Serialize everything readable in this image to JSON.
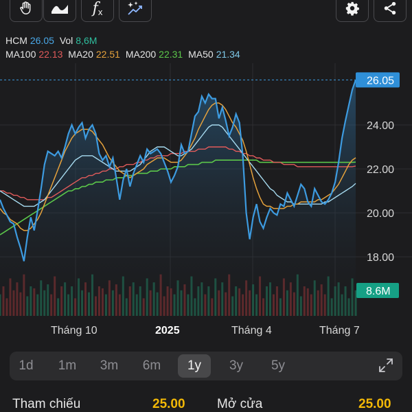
{
  "toolbar": {
    "left_buttons": [
      "hand-icon",
      "area-chart-icon",
      "function-icon",
      "sparkle-chart-icon"
    ],
    "right_buttons": [
      "gear-icon",
      "share-icon"
    ]
  },
  "legend": {
    "symbol": "HCM",
    "price": "26.05",
    "vol_label": "Vol",
    "vol": "8,6M",
    "ma": [
      {
        "label": "MA100",
        "value": "22.13",
        "color": "#e25b5b"
      },
      {
        "label": "MA20",
        "value": "22.51",
        "color": "#e6a23c"
      },
      {
        "label": "MA200",
        "value": "22.31",
        "color": "#5cc84a"
      },
      {
        "label": "MA50",
        "value": "21.34",
        "color": "#7ec8e8"
      }
    ]
  },
  "chart_data": {
    "type": "line",
    "symbol": "HCM",
    "y_ticks": [
      "26.05",
      "24.00",
      "22.00",
      "20.00",
      "18.00"
    ],
    "last_price": "26.05",
    "volume_label": "8.6M",
    "x_ticks": [
      "Tháng 10",
      "2025",
      "Tháng 4",
      "Tháng 7"
    ],
    "ylim": [
      17,
      26.5
    ],
    "price": [
      20.6,
      20.2,
      19.9,
      19.6,
      19.5,
      18.9,
      18.4,
      17.8,
      18.9,
      19.8,
      19.2,
      20.1,
      21.1,
      22.2,
      22.8,
      22.7,
      22.6,
      22.8,
      22.5,
      23.0,
      23.6,
      24.0,
      23.6,
      23.9,
      24.1,
      23.4,
      23.8,
      24.0,
      23.6,
      22.7,
      22.4,
      22.6,
      22.1,
      22.5,
      21.6,
      20.6,
      21.5,
      22.0,
      21.2,
      21.8,
      22.2,
      22.6,
      22.3,
      22.9,
      22.7,
      22.8,
      22.9,
      22.7,
      22.3,
      21.9,
      21.4,
      21.7,
      22.1,
      23.1,
      22.7,
      22.8,
      23.6,
      24.4,
      24.6,
      25.3,
      25.0,
      25.4,
      25.2,
      25.2,
      24.3,
      24.8,
      24.2,
      23.5,
      23.9,
      24.5,
      24.1,
      22.6,
      20.0,
      18.8,
      19.8,
      20.4,
      19.6,
      19.3,
      19.8,
      20.2,
      20.0,
      19.9,
      20.4,
      20.3,
      20.9,
      20.6,
      20.3,
      20.8,
      21.3,
      21.1,
      20.5,
      20.3,
      21.1,
      20.8,
      20.5,
      20.4,
      20.6,
      20.9,
      21.4,
      22.3,
      23.4,
      24.2,
      24.9,
      25.6,
      26.05
    ],
    "ma20": [
      20.2,
      20.0,
      19.9,
      19.7,
      19.6,
      19.5,
      19.3,
      19.2,
      19.2,
      19.3,
      19.5,
      19.7,
      20.0,
      20.4,
      20.8,
      21.2,
      21.6,
      22.0,
      22.4,
      22.8,
      23.1,
      23.4,
      23.6,
      23.7,
      23.8,
      23.8,
      23.8,
      23.7,
      23.5,
      23.3,
      23.1,
      22.8,
      22.5,
      22.3,
      22.1,
      21.9,
      21.8,
      21.7,
      21.6,
      21.7,
      21.8,
      21.9,
      22.0,
      22.2,
      22.3,
      22.4,
      22.5,
      22.5,
      22.5,
      22.4,
      22.3,
      22.3,
      22.3,
      22.4,
      22.6,
      22.8,
      23.1,
      23.4,
      23.8,
      24.1,
      24.4,
      24.7,
      24.9,
      25.0,
      25.0,
      24.9,
      24.7,
      24.4,
      24.1,
      23.9,
      23.6,
      23.3,
      22.8,
      22.2,
      21.6,
      21.1,
      20.7,
      20.4,
      20.3,
      20.3,
      20.2,
      20.2,
      20.2,
      20.2,
      20.3,
      20.3,
      20.4,
      20.4,
      20.5,
      20.5,
      20.5,
      20.5,
      20.5,
      20.6,
      20.6,
      20.7,
      20.8,
      20.9,
      21.1,
      21.3,
      21.6,
      21.9,
      22.2,
      22.4,
      22.51
    ],
    "ma50": [
      21.0,
      20.9,
      20.8,
      20.7,
      20.6,
      20.5,
      20.4,
      20.3,
      20.3,
      20.3,
      20.3,
      20.4,
      20.5,
      20.6,
      20.8,
      21.0,
      21.2,
      21.4,
      21.6,
      21.8,
      22.0,
      22.2,
      22.4,
      22.5,
      22.6,
      22.6,
      22.6,
      22.6,
      22.5,
      22.4,
      22.3,
      22.2,
      22.1,
      22.0,
      21.9,
      21.9,
      21.9,
      21.9,
      21.9,
      22.0,
      22.1,
      22.2,
      22.4,
      22.6,
      22.8,
      22.9,
      23.0,
      23.0,
      23.0,
      22.9,
      22.8,
      22.7,
      22.6,
      22.6,
      22.7,
      22.8,
      22.9,
      23.1,
      23.3,
      23.5,
      23.7,
      23.9,
      24.0,
      24.0,
      24.0,
      23.9,
      23.7,
      23.5,
      23.3,
      23.1,
      22.9,
      22.7,
      22.5,
      22.3,
      22.1,
      21.9,
      21.7,
      21.5,
      21.3,
      21.1,
      21.0,
      20.8,
      20.7,
      20.6,
      20.5,
      20.5,
      20.4,
      20.4,
      20.4,
      20.4,
      20.4,
      20.4,
      20.4,
      20.4,
      20.4,
      20.5,
      20.5,
      20.6,
      20.7,
      20.8,
      20.9,
      21.0,
      21.1,
      21.2,
      21.34
    ],
    "ma100": [
      21.0,
      21.0,
      20.9,
      20.9,
      20.8,
      20.8,
      20.7,
      20.7,
      20.6,
      20.6,
      20.6,
      20.6,
      20.6,
      20.6,
      20.7,
      20.7,
      20.8,
      20.9,
      21.0,
      21.1,
      21.2,
      21.3,
      21.4,
      21.5,
      21.6,
      21.6,
      21.7,
      21.7,
      21.8,
      21.8,
      21.9,
      21.9,
      22.0,
      22.0,
      22.0,
      22.1,
      22.1,
      22.2,
      22.2,
      22.2,
      22.3,
      22.3,
      22.4,
      22.4,
      22.5,
      22.5,
      22.6,
      22.6,
      22.6,
      22.6,
      22.7,
      22.7,
      22.7,
      22.7,
      22.8,
      22.8,
      22.8,
      22.8,
      22.9,
      22.9,
      22.9,
      23.0,
      23.0,
      23.0,
      23.0,
      23.0,
      23.0,
      22.9,
      22.9,
      22.8,
      22.8,
      22.7,
      22.7,
      22.6,
      22.6,
      22.5,
      22.5,
      22.4,
      22.4,
      22.4,
      22.3,
      22.3,
      22.3,
      22.2,
      22.2,
      22.2,
      22.2,
      22.1,
      22.1,
      22.1,
      22.1,
      22.1,
      22.1,
      22.1,
      22.1,
      22.1,
      22.1,
      22.1,
      22.1,
      22.1,
      22.1,
      22.1,
      22.1,
      22.1,
      22.13
    ],
    "ma200": [
      19.0,
      19.1,
      19.2,
      19.3,
      19.4,
      19.5,
      19.6,
      19.7,
      19.8,
      19.9,
      20.0,
      20.1,
      20.2,
      20.3,
      20.4,
      20.5,
      20.6,
      20.7,
      20.8,
      20.9,
      21.0,
      21.0,
      21.1,
      21.1,
      21.2,
      21.2,
      21.3,
      21.3,
      21.4,
      21.4,
      21.4,
      21.5,
      21.5,
      21.5,
      21.6,
      21.6,
      21.6,
      21.7,
      21.7,
      21.7,
      21.8,
      21.8,
      21.8,
      21.8,
      21.9,
      21.9,
      21.9,
      22.0,
      22.0,
      22.0,
      22.0,
      22.1,
      22.1,
      22.1,
      22.1,
      22.2,
      22.2,
      22.2,
      22.2,
      22.3,
      22.3,
      22.3,
      22.3,
      22.4,
      22.4,
      22.4,
      22.4,
      22.4,
      22.4,
      22.4,
      22.4,
      22.4,
      22.4,
      22.4,
      22.4,
      22.4,
      22.3,
      22.3,
      22.3,
      22.3,
      22.3,
      22.3,
      22.3,
      22.3,
      22.3,
      22.3,
      22.3,
      22.3,
      22.3,
      22.3,
      22.3,
      22.3,
      22.3,
      22.3,
      22.3,
      22.3,
      22.3,
      22.3,
      22.3,
      22.3,
      22.3,
      22.3,
      22.3,
      22.3,
      22.31
    ],
    "grid": true
  },
  "ranges": {
    "items": [
      "1d",
      "1m",
      "3m",
      "6m",
      "1y",
      "3y",
      "5y"
    ],
    "active": "1y"
  },
  "stats": {
    "ref_label": "Tham chiếu",
    "ref_value": "25.00",
    "open_label": "Mở cửa",
    "open_value": "25.00"
  }
}
